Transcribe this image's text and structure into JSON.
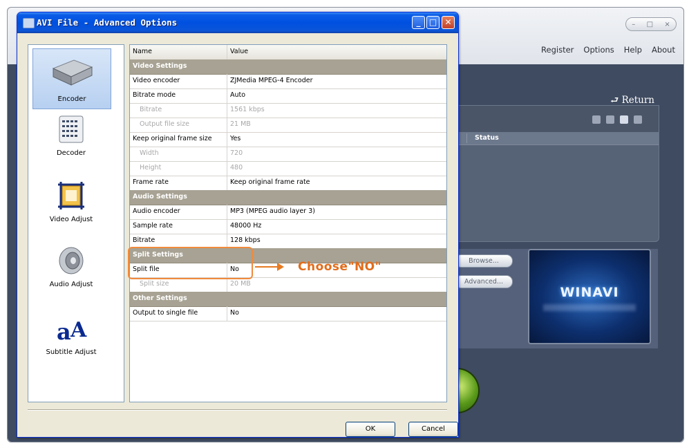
{
  "app": {
    "window_buttons": [
      "–",
      "□",
      "×"
    ],
    "menu": [
      "Register",
      "Options",
      "Help",
      "About"
    ],
    "return_label": "⮐ Return",
    "status_header": "Status",
    "browse_button": "Browse...",
    "advanced_button": "Advanced...",
    "logo_text": "WINAVI"
  },
  "dialog": {
    "title": "AVI File - Advanced Options",
    "title_buttons": {
      "minimize": "_",
      "maximize": "□",
      "close": "✕"
    },
    "categories": [
      {
        "label": "Encoder",
        "icon": "encoder-icon",
        "selected": true
      },
      {
        "label": "Decoder",
        "icon": "decoder-icon",
        "selected": false
      },
      {
        "label": "Video Adjust",
        "icon": "video-adjust-icon",
        "selected": false
      },
      {
        "label": "Audio Adjust",
        "icon": "audio-adjust-icon",
        "selected": false
      },
      {
        "label": "Subtitle Adjust",
        "icon": "subtitle-adjust-icon",
        "selected": false
      }
    ],
    "grid": {
      "columns": [
        "Name",
        "Value"
      ],
      "rows": [
        {
          "type": "section",
          "name": "Video Settings"
        },
        {
          "type": "row",
          "name": "Video encoder",
          "value": "ZJMedia MPEG-4 Encoder"
        },
        {
          "type": "row",
          "name": "Bitrate mode",
          "value": "Auto"
        },
        {
          "type": "disabled",
          "name": "Bitrate",
          "value": "1561 kbps"
        },
        {
          "type": "disabled",
          "name": "Output file size",
          "value": "21 MB"
        },
        {
          "type": "row",
          "name": "Keep original frame size",
          "value": "Yes"
        },
        {
          "type": "disabled",
          "name": "Width",
          "value": "720"
        },
        {
          "type": "disabled",
          "name": "Height",
          "value": "480"
        },
        {
          "type": "row",
          "name": "Frame rate",
          "value": "Keep original frame rate"
        },
        {
          "type": "section",
          "name": "Audio Settings"
        },
        {
          "type": "row",
          "name": "Audio encoder",
          "value": "MP3 (MPEG audio layer 3)"
        },
        {
          "type": "row",
          "name": "Sample rate",
          "value": "48000 Hz"
        },
        {
          "type": "row",
          "name": "Bitrate",
          "value": "128 kbps"
        },
        {
          "type": "section",
          "name": "Split Settings"
        },
        {
          "type": "row",
          "name": "Split file",
          "value": "No"
        },
        {
          "type": "disabled",
          "name": "Split size",
          "value": "20 MB"
        },
        {
          "type": "section",
          "name": "Other Settings"
        },
        {
          "type": "row",
          "name": "Output to single file",
          "value": "No"
        }
      ]
    },
    "annotation": "Choose\"NO\"",
    "ok_label": "OK",
    "cancel_label": "Cancel"
  }
}
